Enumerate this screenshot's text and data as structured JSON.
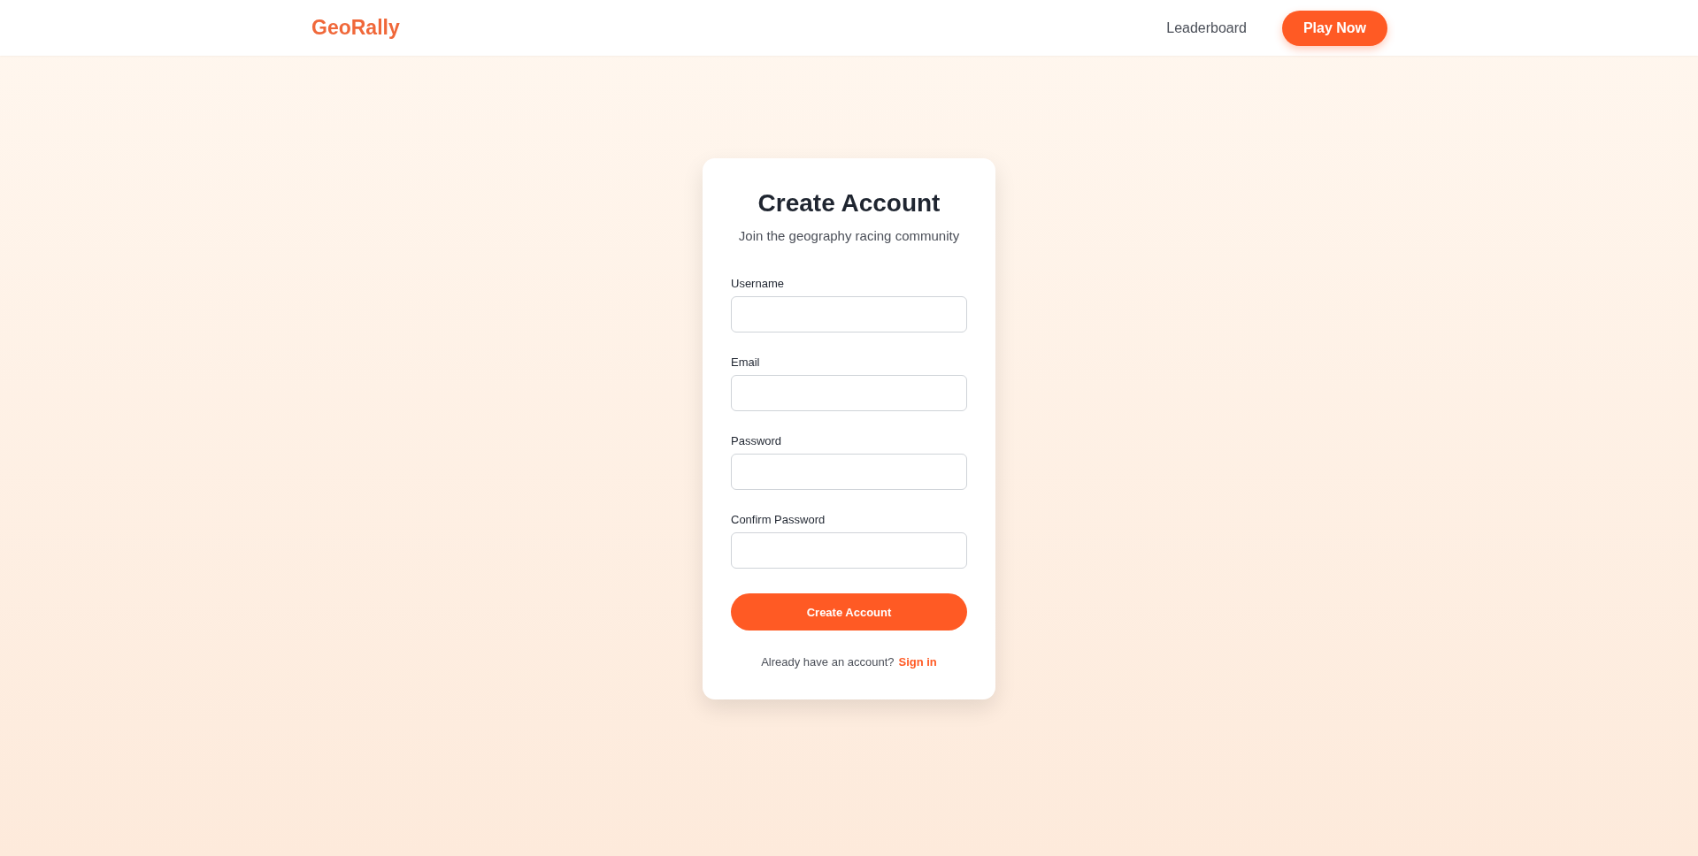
{
  "header": {
    "logo": "GeoRally",
    "nav": [
      {
        "label": "Leaderboard",
        "kind": "link"
      },
      {
        "label": "Play Now",
        "kind": "button"
      }
    ]
  },
  "card": {
    "title": "Create Account",
    "subtitle": "Join the geography racing community",
    "fields": [
      {
        "label": "Username"
      },
      {
        "label": "Email"
      },
      {
        "label": "Password"
      },
      {
        "label": "Confirm Password"
      }
    ],
    "submit": "Create Account",
    "footer": {
      "text": "Already have an account?",
      "link": "Sign in"
    }
  }
}
